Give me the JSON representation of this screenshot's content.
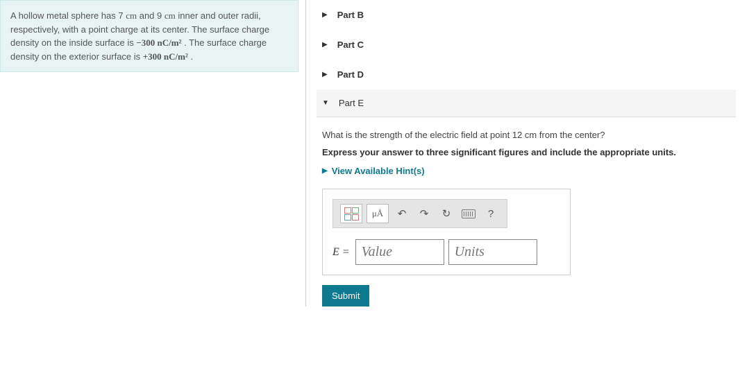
{
  "problem": {
    "text_1": "A hollow metal sphere has 7 ",
    "cm1": "cm",
    "text_2": " and 9 ",
    "cm2": "cm",
    "text_3": " inner and outer radii, respectively, with a point charge at its center. The surface charge density on the inside surface is ",
    "sigma_in": "−300 nC/m²",
    "text_4": " . The surface charge density on the exterior surface is ",
    "sigma_out": "+300 nC/m²",
    "text_5": " ."
  },
  "parts": {
    "b": "Part B",
    "c": "Part C",
    "d": "Part D",
    "e": "Part E"
  },
  "partE": {
    "question": "What is the strength of the electric field at point 12 cm from the center?",
    "instruction": "Express your answer to three significant figures and include the appropriate units.",
    "hints": "View Available Hint(s)",
    "mua": "μÅ",
    "eq_label": "E =",
    "value_placeholder": "Value",
    "units_placeholder": "Units",
    "submit": "Submit",
    "help": "?"
  }
}
